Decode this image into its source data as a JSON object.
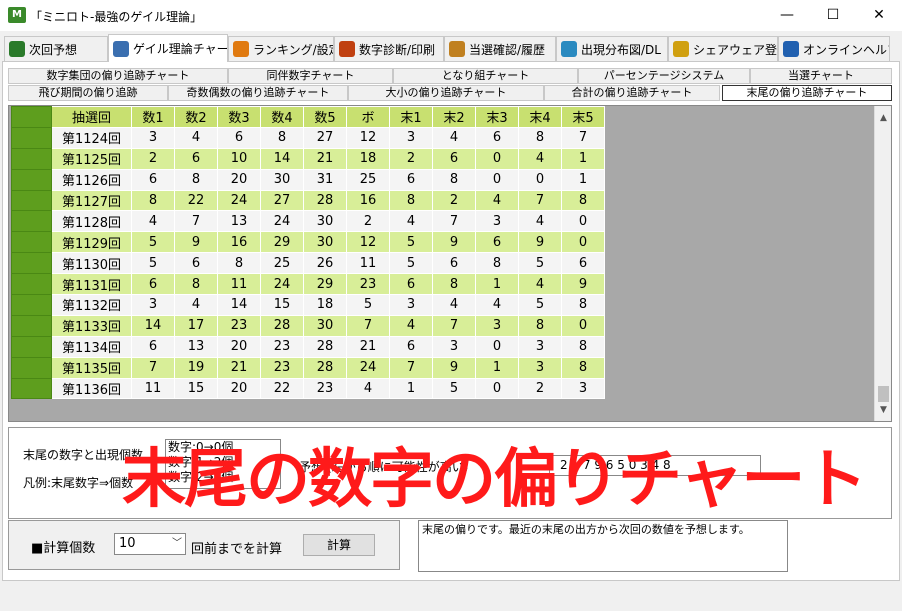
{
  "window": {
    "title": "「ミニロト-最強のゲイル理論」",
    "icon_text": "M",
    "min": "—",
    "max": "☐",
    "close": "✕"
  },
  "main_tabs": [
    {
      "label": "次回予想",
      "color": "#2a7a2a"
    },
    {
      "label": "ゲイル理論チャート",
      "color": "#3b6fb0"
    },
    {
      "label": "ランキング/設定",
      "color": "#e07a10"
    },
    {
      "label": "数字診断/印刷",
      "color": "#c04010"
    },
    {
      "label": "当選確認/履歴",
      "color": "#c08020"
    },
    {
      "label": "出現分布図/DL",
      "color": "#2a8ac0"
    },
    {
      "label": "シェアウェア登録",
      "color": "#d0a010"
    },
    {
      "label": "オンラインヘルプ",
      "color": "#2060b0"
    }
  ],
  "sub_tabs_top": [
    "数字集団の偏り追跡チャート",
    "同伴数字チャート",
    "となり組チャート",
    "パーセンテージシステム",
    "当選チャート"
  ],
  "sub_tabs_bottom": [
    "飛び期間の偏り追跡",
    "奇数偶数の偏り追跡チャート",
    "大小の偏り追跡チャート",
    "合計の偏り追跡チャート",
    "末尾の偏り追跡チャート"
  ],
  "grid": {
    "headers": [
      "抽選回",
      "数1",
      "数2",
      "数3",
      "数4",
      "数5",
      "ボ",
      "末1",
      "末2",
      "末3",
      "末4",
      "末5"
    ],
    "rows": [
      [
        "第1124回",
        "3",
        "4",
        "6",
        "8",
        "27",
        "12",
        "3",
        "4",
        "6",
        "8",
        "7"
      ],
      [
        "第1125回",
        "2",
        "6",
        "10",
        "14",
        "21",
        "18",
        "2",
        "6",
        "0",
        "4",
        "1"
      ],
      [
        "第1126回",
        "6",
        "8",
        "20",
        "30",
        "31",
        "25",
        "6",
        "8",
        "0",
        "0",
        "1"
      ],
      [
        "第1127回",
        "8",
        "22",
        "24",
        "27",
        "28",
        "16",
        "8",
        "2",
        "4",
        "7",
        "8"
      ],
      [
        "第1128回",
        "4",
        "7",
        "13",
        "24",
        "30",
        "2",
        "4",
        "7",
        "3",
        "4",
        "0"
      ],
      [
        "第1129回",
        "5",
        "9",
        "16",
        "29",
        "30",
        "12",
        "5",
        "9",
        "6",
        "9",
        "0"
      ],
      [
        "第1130回",
        "5",
        "6",
        "8",
        "25",
        "26",
        "11",
        "5",
        "6",
        "8",
        "5",
        "6"
      ],
      [
        "第1131回",
        "6",
        "8",
        "11",
        "24",
        "29",
        "23",
        "6",
        "8",
        "1",
        "4",
        "9"
      ],
      [
        "第1132回",
        "3",
        "4",
        "14",
        "15",
        "18",
        "5",
        "3",
        "4",
        "4",
        "5",
        "8"
      ],
      [
        "第1133回",
        "14",
        "17",
        "23",
        "28",
        "30",
        "7",
        "4",
        "7",
        "3",
        "8",
        "0"
      ],
      [
        "第1134回",
        "6",
        "13",
        "20",
        "23",
        "28",
        "21",
        "6",
        "3",
        "0",
        "3",
        "8"
      ],
      [
        "第1135回",
        "7",
        "19",
        "21",
        "23",
        "28",
        "24",
        "7",
        "9",
        "1",
        "3",
        "8"
      ],
      [
        "第1136回",
        "11",
        "15",
        "20",
        "22",
        "23",
        "4",
        "1",
        "5",
        "0",
        "2",
        "3"
      ]
    ]
  },
  "info": {
    "label1": "末尾の数字と出現個数",
    "label2": "凡例:末尾数字⇒個数",
    "list_items": [
      "数字:0→0個",
      "数字:1→2個",
      "数字:2→1個"
    ],
    "predict_label": "予想:(左から順に可能性が高い)",
    "predict_value": "2   1   7   9   6   5   0   3   4   8"
  },
  "calc": {
    "label": "■計算個数",
    "count": "10",
    "suffix": "回前までを計算",
    "button": "計算"
  },
  "description": "末尾の偏りです。最近の末尾の出方から次回の数値を予想します。",
  "overlay_title": "末尾の数字の偏りチャート"
}
